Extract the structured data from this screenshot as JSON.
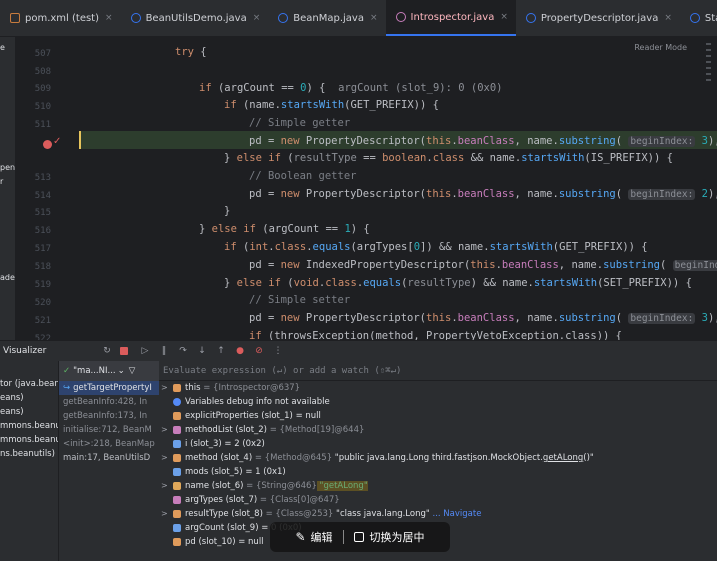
{
  "tabs": [
    {
      "label": "pom.xml (test)",
      "icon": "maven-xml-icon",
      "active": false
    },
    {
      "label": "BeanUtilsDemo.java",
      "icon": "java-class-icon",
      "active": false
    },
    {
      "label": "BeanMap.java",
      "icon": "java-class-icon",
      "active": false
    },
    {
      "label": "Introspector.java",
      "icon": "java-class-icon",
      "active": true
    },
    {
      "label": "PropertyDescriptor.java",
      "icon": "java-class-icon",
      "active": false
    },
    {
      "label": "StaticUtilsTest.java",
      "icon": "java-class-icon",
      "active": false
    }
  ],
  "tab_close_glyph": "×",
  "tab_overflow_glyph": "⌄",
  "reader_mode": "Reader Mode",
  "left_strip": [
    "e",
    "pent",
    "r",
    "ader"
  ],
  "line_numbers": [
    "507",
    "508",
    "509",
    "510",
    "511",
    "512",
    "513",
    "514",
    "515",
    "516",
    "517",
    "518",
    "519",
    "520",
    "521",
    "522"
  ],
  "breakpoint_glyph": "✓",
  "code": {
    "l507_kw": "try",
    "l507_rest": " {",
    "l510_kw": "if",
    "l510_a": " (argCount == ",
    "l510_num": "0",
    "l510_b": ") {",
    "l510_hint": "argCount (slot_9): 0 (0x0)",
    "l511_kw": "if",
    "l511_a": " (name.",
    "l511_fn": "startsWith",
    "l511_b": "(GET_PREFIX)) {",
    "l512_cmt": "// Simple getter",
    "l513_a": "pd = ",
    "l513_kw": "new",
    "l513_b": " PropertyDescriptor(",
    "l513_kw2": "this",
    "l513_c": ".",
    "l513_fld": "beanClass",
    "l513_d": ", name.",
    "l513_fn": "substring",
    "l513_e": "(",
    "l513_hint": "beginIndex:",
    "l513_num": " 3",
    "l513_f": "), met",
    "l514_a": "} ",
    "l514_kw": "else if",
    "l514_b": " (",
    "l514_v": "resultType",
    "l514_c": " == ",
    "l514_kw2": "boolean",
    "l514_d": ".",
    "l514_kw3": "class",
    "l514_e": " && name.",
    "l514_fn": "startsWith",
    "l514_f": "(IS_PREFIX)) {",
    "l515_cmt": "// Boolean getter",
    "l516_a": "pd = ",
    "l516_kw": "new",
    "l516_b": " PropertyDescriptor(",
    "l516_kw2": "this",
    "l516_c": ".",
    "l516_fld": "beanClass",
    "l516_d": ", name.",
    "l516_fn": "substring",
    "l516_e": "(",
    "l516_hint": "beginIndex:",
    "l516_num": " 2",
    "l516_f": "), met",
    "l517": "}",
    "l518_a": "} ",
    "l518_kw": "else if",
    "l518_b": " (argCount == ",
    "l518_num": "1",
    "l518_c": ") {",
    "l519_kw": "if",
    "l519_a": " (",
    "l519_kw2": "int",
    "l519_b": ".",
    "l519_kw3": "class",
    "l519_c": ".",
    "l519_fn": "equals",
    "l519_d": "(argTypes[",
    "l519_num": "0",
    "l519_e": "]) && name.",
    "l519_fn2": "startsWith",
    "l519_f": "(GET_PREFIX)) {",
    "l520_a": "pd = ",
    "l520_kw": "new",
    "l520_b": " IndexedPropertyDescriptor(",
    "l520_kw2": "this",
    "l520_c": ".",
    "l520_fld": "beanClass",
    "l520_d": ", name.",
    "l520_fn": "substring",
    "l520_e": "(",
    "l520_hint": "beginIndex:",
    "l521_a": "} ",
    "l521_kw": "else if",
    "l521_b": " (",
    "l521_kw2": "void",
    "l521_c": ".",
    "l521_kw3": "class",
    "l521_d": ".",
    "l521_fn": "equals",
    "l521_e": "(",
    "l521_v": "resultType",
    "l521_f": ") && name.",
    "l521_fn2": "startsWith",
    "l521_g": "(SET_PREFIX)) {",
    "l522_cmt": "// Simple setter",
    "l523_a": "pd = ",
    "l523_kw": "new",
    "l523_b": " PropertyDescriptor(",
    "l523_kw2": "this",
    "l523_c": ".",
    "l523_fld": "beanClass",
    "l523_d": ", name.",
    "l523_fn": "substring",
    "l523_e": "(",
    "l523_hint": "beginIndex:",
    "l523_num": " 3",
    "l523_f": "),  rea",
    "l524_kw": "if",
    "l524_a": " (throwsException(method, PropertyVetoException.class)) {"
  },
  "debugger": {
    "title": "Visualizer",
    "toolbar_icons": [
      "rerun-icon",
      "stop-icon",
      "resume-icon",
      "pause-icon",
      "step-over-icon",
      "step-into-icon",
      "step-out-icon",
      "view-breakpoints-icon",
      "mute-breakpoints-icon",
      "more-icon"
    ],
    "toolbar_glyphs": [
      "↻",
      "",
      "▷",
      "‖",
      "↷",
      "↓",
      "↑",
      "●",
      "⊘",
      "⋮"
    ],
    "threads": [
      "tor (java.beans",
      "eans)",
      "eans)",
      "mmons.beanu",
      "mmons.beanutil",
      "ns.beanutils)"
    ],
    "frames_header": "\"ma...NI...",
    "frames_check": "✓",
    "frames_filter": "▽",
    "frames_filter2": "⌄",
    "frames": [
      {
        "label": "getTargetPropertyI",
        "selected": true,
        "plain": false
      },
      {
        "label": "getBeanInfo:428, In",
        "selected": false,
        "plain": false
      },
      {
        "label": "getBeanInfo:173, In",
        "selected": false,
        "plain": false
      },
      {
        "label": "initialise:712, BeanM",
        "selected": false,
        "plain": false
      },
      {
        "label": "<init>:218, BeanMap",
        "selected": false,
        "plain": false
      },
      {
        "label": "main:17, BeanUtilsD",
        "selected": false,
        "plain": true
      }
    ],
    "return_glyph": "↪",
    "eval_placeholder": "Evaluate expression (↵) or add a watch (⇧⌘↵)",
    "variables": {
      "this_name": "this",
      "this_val": " = {Introspector@637}",
      "info": "Variables debug info not available",
      "explicit": "explicitProperties (slot_1) = null",
      "methodList_name": "methodList (slot_2)",
      "methodList_val": " = {Method[19]@644}",
      "i": "i (slot_3) = 2 (0x2)",
      "method_name": "method (slot_4)",
      "method_ref": " = {Method@645}",
      "method_str": " \"public java.lang.Long third.fastjson.MockObject.",
      "method_hl": "getALong",
      "method_str2": "()\"",
      "mods": "mods (slot_5) = 1 (0x1)",
      "name_name": "name (slot_6)",
      "name_ref": " = {String@646}",
      "name_val": " \"getALong\"",
      "argTypes_name": "argTypes (slot_7)",
      "argTypes_val": " = {Class[0]@647}",
      "resultType_name": "resultType (slot_8)",
      "resultType_ref": " = {Class@253}",
      "resultType_val": " \"class java.lang.Long\"",
      "resultType_nav": " ... Navigate",
      "argCount": "argCount (slot_9) = 0 (0x0)",
      "pd": "pd (slot_10) = null"
    },
    "expand_glyph": ">"
  },
  "overlay": {
    "edit_label": "编辑",
    "center_label": "切换为居中",
    "edit_glyph": "✎"
  }
}
